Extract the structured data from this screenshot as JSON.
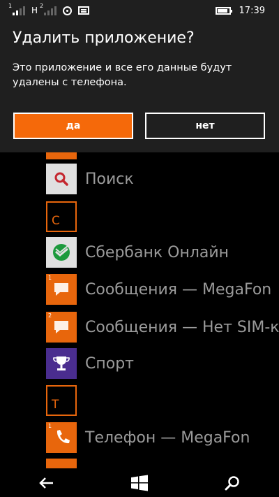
{
  "status": {
    "network": "H",
    "sim_indicator": "2",
    "time": "17:39",
    "battery_level": 0.9
  },
  "dialog": {
    "title": "Удалить приложение?",
    "message": "Это приложение и все его данные будут удалены с телефона.",
    "yes_label": "да",
    "no_label": "нет"
  },
  "apps": [
    {
      "type": "app",
      "name": "Поиск",
      "tile_color": "#e0e0e0",
      "icon": "search-icon"
    },
    {
      "type": "letter",
      "letter": "С"
    },
    {
      "type": "app",
      "name": "Сбербанк Онлайн",
      "tile_color": "#e0e0e0",
      "icon": "sberbank-logo-icon"
    },
    {
      "type": "app",
      "name": "Сообщения — MegaFon",
      "tile_color": "#e8660c",
      "icon": "message-icon",
      "badge": "1"
    },
    {
      "type": "app",
      "name": "Сообщения — Нет SIM-к",
      "tile_color": "#e8660c",
      "icon": "message-icon",
      "badge": "2"
    },
    {
      "type": "app",
      "name": "Спорт",
      "tile_color": "#4a2d8f",
      "icon": "trophy-icon"
    },
    {
      "type": "letter",
      "letter": "Т"
    },
    {
      "type": "app",
      "name": "Телефон — MegaFon",
      "tile_color": "#e8660c",
      "icon": "phone-icon",
      "badge": "1"
    }
  ],
  "colors": {
    "accent": "#e8660c",
    "dialog_background": "#1f1f1f",
    "primary_button": "#f5690a"
  },
  "navbar": {
    "back_icon": "back-arrow-icon",
    "start_icon": "windows-logo-icon",
    "search_icon": "search-icon"
  }
}
